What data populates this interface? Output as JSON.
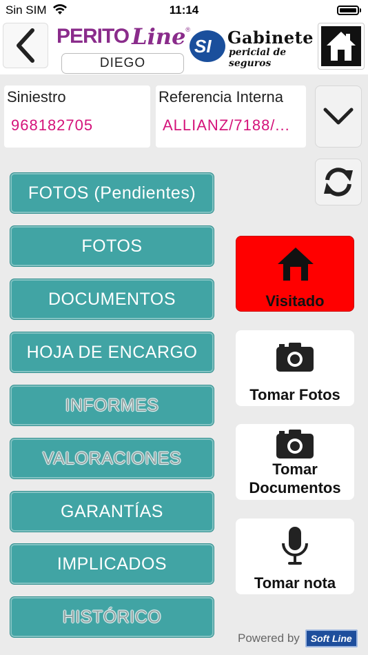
{
  "status": {
    "carrier": "Sin SIM",
    "time": "11:14"
  },
  "header": {
    "logo_perito": "PERITO",
    "logo_line": "Line",
    "logo_reg": "®",
    "user": "DIEGO",
    "logo_gabinete_title": "Gabinete",
    "logo_gabinete_sub": "pericial de seguros",
    "logo_si": "SI"
  },
  "fields": [
    {
      "label": "Siniestro",
      "value": "968182705"
    },
    {
      "label": "Referencia Interna",
      "value": "ALLIANZ/7188/..."
    }
  ],
  "menu": [
    {
      "label": "FOTOS (Pendientes)",
      "enabled": true
    },
    {
      "label": "FOTOS",
      "enabled": true
    },
    {
      "label": "DOCUMENTOS",
      "enabled": true
    },
    {
      "label": "HOJA DE ENCARGO",
      "enabled": true
    },
    {
      "label": "INFORMES",
      "enabled": false
    },
    {
      "label": "VALORACIONES",
      "enabled": false
    },
    {
      "label": "GARANTÍAS",
      "enabled": true
    },
    {
      "label": "IMPLICADOS",
      "enabled": true
    },
    {
      "label": "HISTÓRICO",
      "enabled": false
    }
  ],
  "actions": {
    "visitado": "Visitado",
    "tomar_fotos": "Tomar Fotos",
    "tomar_documentos_1": "Tomar",
    "tomar_documentos_2": "Documentos",
    "tomar_nota": "Tomar nota"
  },
  "footer": {
    "powered": "Powered by",
    "brand": "Soft Line"
  },
  "colors": {
    "accent_teal": "#41a4a4",
    "brand_purple": "#8a2c8b",
    "value_pink": "#d4127a",
    "visitado_red": "#ff0000"
  }
}
